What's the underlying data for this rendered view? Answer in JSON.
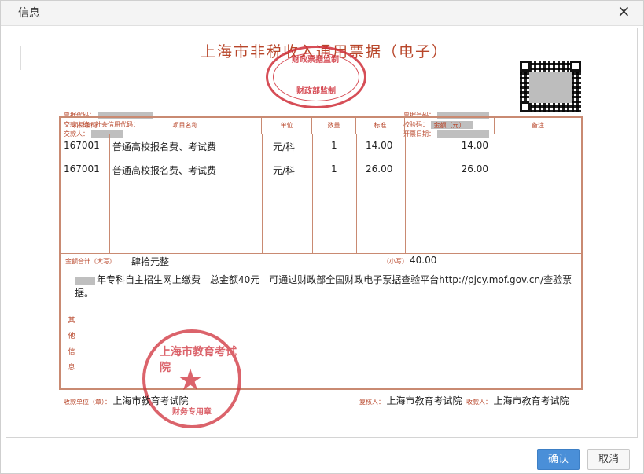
{
  "dialog": {
    "title": "信息",
    "close_glyph": "×",
    "ok_label": "确认",
    "cancel_label": "取消"
  },
  "receipt": {
    "title": "上海市非税收入通用票据（电子）",
    "stamp_top_text": [
      "财政票据监制",
      "财政部监制"
    ],
    "meta_left": {
      "code_label": "票据代码：",
      "payer_credit_label": "交款人统一社会信用代码：",
      "payer_label": "交款人："
    },
    "meta_right": {
      "number_label": "票据号码：",
      "check_label": "校验码：",
      "date_label": "开票日期："
    },
    "headers": [
      "项目编码",
      "项目名称",
      "单位",
      "数量",
      "标准",
      "金额（元）",
      "备注"
    ],
    "rows": [
      {
        "code": "167001",
        "name": "普通高校报名费、考试费",
        "unit": "元/科",
        "qty": "1",
        "std": "14.00",
        "amount": "14.00"
      },
      {
        "code": "167001",
        "name": "普通高校报名费、考试费",
        "unit": "元/科",
        "qty": "1",
        "std": "26.00",
        "amount": "26.00"
      }
    ],
    "total_caps_label": "金额合计（大写）",
    "total_caps_value": "肆拾元整",
    "total_small_label": "（小写）",
    "total_small_value": "40.00",
    "other_info_label": [
      "其",
      "他",
      "信",
      "息"
    ],
    "other_info_text": "年专科自主招生网上缴费　总金额40元　可通过财政部全国财政电子票据查验平台http://pjcy.mof.gov.cn/查验票据。",
    "stamp_bottom_text": [
      "上海市教育考试院",
      "财务专用章"
    ],
    "payee_label": "收款单位（章）：",
    "payee_value": "上海市教育考试院",
    "reviewer_label": "复核人：",
    "reviewer_value": "上海市教育考试院",
    "collector_label": "收款人：",
    "collector_value": "上海市教育考试院"
  }
}
